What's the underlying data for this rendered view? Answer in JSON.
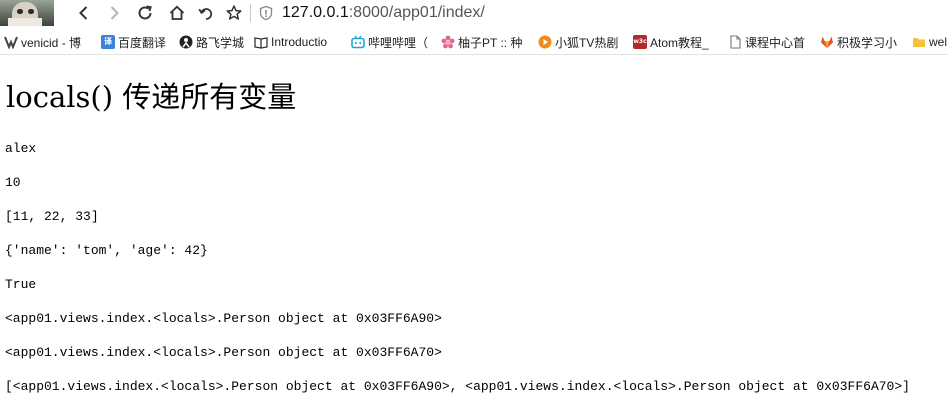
{
  "browser": {
    "url_host": "127.0.0.1",
    "url_path": ":8000/app01/index/"
  },
  "bookmarks": [
    {
      "label": "venicid - 博",
      "icon": "venicid-favicon"
    },
    {
      "label": "百度翻译",
      "icon": "baidu-translate-icon",
      "icon_text": "译",
      "color": "#3b82d8"
    },
    {
      "label": "路飞学城",
      "icon": "luffy-icon"
    },
    {
      "label": "Introductio",
      "icon": "book-icon"
    },
    {
      "label": "哔哩哔哩（",
      "icon": "bilibili-icon",
      "color": "#22a3e0"
    },
    {
      "label": "柚子PT :: 种",
      "icon": "flower-icon",
      "color": "#e0679a"
    },
    {
      "label": "小狐TV热剧",
      "icon": "play-icon",
      "color": "#f08c1a"
    },
    {
      "label": "Atom教程_",
      "icon": "w3c-icon",
      "icon_text": "w3c",
      "color": "#b22a2a"
    },
    {
      "label": "课程中心首",
      "icon": "page-icon"
    },
    {
      "label": "积极学习小",
      "icon": "gitlab-fox-icon",
      "color": "#e2562a"
    },
    {
      "label": "wel",
      "icon": "folder-icon",
      "color": "#f3c13a"
    }
  ],
  "page": {
    "heading": "locals() 传递所有变量",
    "lines": [
      "alex",
      "10",
      "[11, 22, 33]",
      "{'name': 'tom', 'age': 42}",
      "True",
      "<app01.views.index.<locals>.Person object at 0x03FF6A90>",
      "<app01.views.index.<locals>.Person object at 0x03FF6A70>",
      "[<app01.views.index.<locals>.Person object at 0x03FF6A90>, <app01.views.index.<locals>.Person object at 0x03FF6A70>]"
    ]
  }
}
